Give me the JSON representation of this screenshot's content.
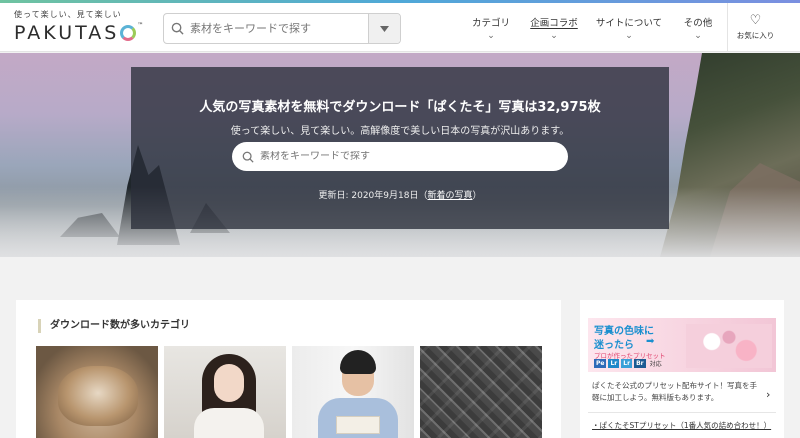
{
  "header": {
    "logo_tagline": "使って楽しい、見て楽しい",
    "logo_word": "PAKUTAS",
    "logo_tm": "™",
    "search_placeholder": "素材をキーワードで探す",
    "nav": [
      {
        "label": "カテゴリ"
      },
      {
        "label": "企画コラボ"
      },
      {
        "label": "サイトについて"
      },
      {
        "label": "その他"
      }
    ],
    "favorites_label": "お気に入り"
  },
  "hero": {
    "title": "人気の写真素材を無料でダウンロード「ぱくたそ」写真は32,975枚",
    "subtitle": "使って楽しい、見て楽しい。高解像度で美しい日本の写真が沢山あります。",
    "search_placeholder": "素材をキーワードで探す",
    "update_prefix": "更新日: 2020年9月18日（",
    "update_link": "新着の写真",
    "update_suffix": "）"
  },
  "main": {
    "section_title": "ダウンロード数が多いカテゴリ"
  },
  "sidebar": {
    "banner_line1": "写真の色味に",
    "banner_line2": "迷ったら",
    "banner_arrow": "➡",
    "banner_line3": "プロが作ったプリセット",
    "banner_badges": [
      "Pe",
      "Lr",
      "Lr",
      "Br"
    ],
    "banner_badge_suffix": "対応",
    "description": "ぱくたそ公式のプリセット配布サイト！写真を手軽に加工しよう。無料版もあります。",
    "link_label": "・ぱくたそSTプリセット（1番人気の詰め合わせ！）"
  },
  "colors": {
    "accent_blue": "#1a8fcf",
    "hero_panel": "#2a2e3a",
    "logo_blue": "#5bb3d6"
  }
}
